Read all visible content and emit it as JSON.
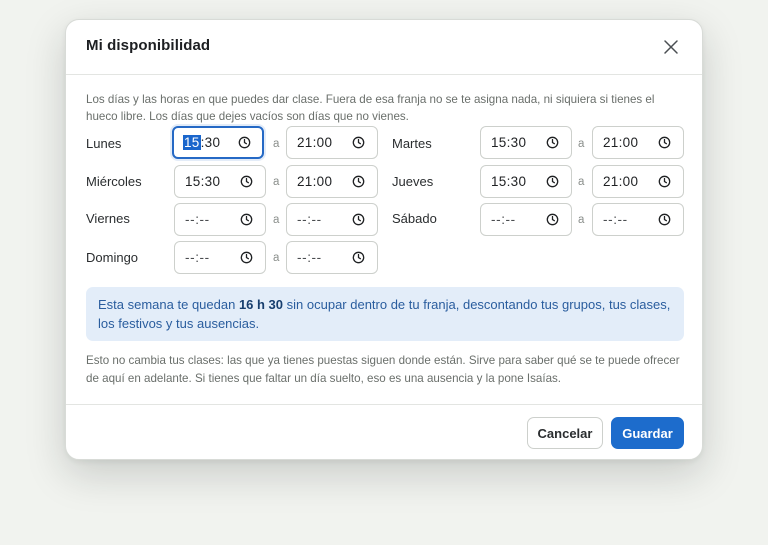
{
  "dialog": {
    "title": "Mi disponibilidad",
    "intro": "Los días y las horas en que puedes dar clase. Fuera de esa franja no se te asigna nada, ni siquiera si tienes el hueco libre. Los días que dejes vacíos son días que no vienes.",
    "separator": "a",
    "empty_time": "--:--"
  },
  "days": [
    {
      "key": "lunes",
      "label": "Lunes",
      "from": "15:30",
      "to": "21:00",
      "focused": true,
      "selected_part": "15"
    },
    {
      "key": "martes",
      "label": "Martes",
      "from": "15:30",
      "to": "21:00"
    },
    {
      "key": "miercoles",
      "label": "Miércoles",
      "from": "15:30",
      "to": "21:00"
    },
    {
      "key": "jueves",
      "label": "Jueves",
      "from": "15:30",
      "to": "21:00"
    },
    {
      "key": "viernes",
      "label": "Viernes",
      "from": "--:--",
      "to": "--:--"
    },
    {
      "key": "sabado",
      "label": "Sábado",
      "from": "--:--",
      "to": "--:--"
    },
    {
      "key": "domingo",
      "label": "Domingo",
      "from": "--:--",
      "to": "--:--"
    }
  ],
  "info": {
    "prefix": "Esta semana te quedan ",
    "highlight": "16 h 30",
    "suffix": " sin ocupar dentro de tu franja, descontando tus grupos, tus clases, los festivos y tus ausencias."
  },
  "note": "Esto no cambia tus clases: las que ya tienes puestas siguen donde están. Sirve para saber qué se te puede ofrecer de aquí en adelante. Si tienes que faltar un día suelto, eso es una ausencia y la pone Isaías.",
  "footer": {
    "cancel_label": "Cancelar",
    "save_label": "Guardar"
  },
  "icons": {
    "close": "close-icon",
    "clock": "clock-icon"
  },
  "colors": {
    "accent": "#1d6ccc",
    "info_bg": "#e3edf9",
    "info_text": "#2a5d9e"
  }
}
